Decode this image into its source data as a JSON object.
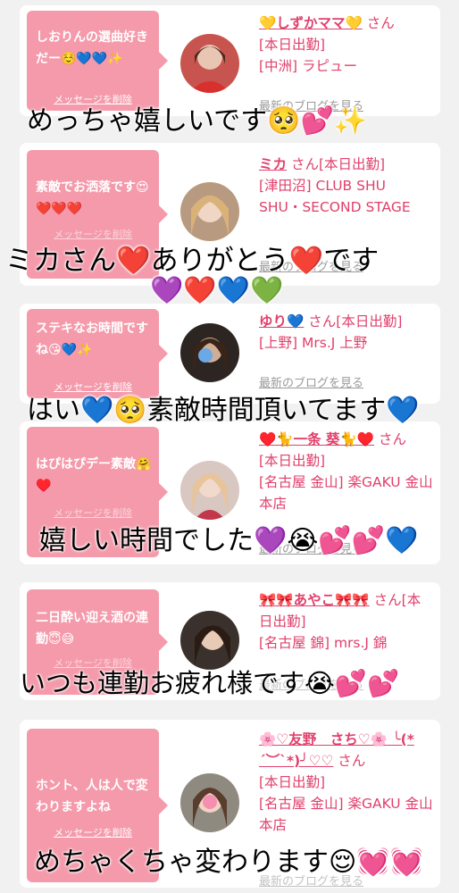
{
  "cards": [
    {
      "message": "しおりんの選曲好きだー☺️💙💙✨",
      "delete_label": "メッセージを削除",
      "name": "💛しずかママ💛",
      "san": "さん",
      "status": "[本日出勤]",
      "store": "[中洲] ラピュー",
      "blog_label": "最新のブログを見る"
    },
    {
      "message": "素敵でお洒落です😍❤️❤️❤️",
      "delete_label": "メッセージを削除",
      "name": "ミカ",
      "san": "さん",
      "status": "[本日出勤]",
      "store": "[津田沼] CLUB SHU SHU・SECOND STAGE",
      "blog_label": "最新のブログを見る"
    },
    {
      "message": "ステキなお時間ですね😘💙✨",
      "delete_label": "メッセージを削除",
      "name": "ゆり💙",
      "san": "さん",
      "status": "[本日出勤]",
      "store": "[上野] Mrs.J 上野",
      "blog_label": "最新のブログを見る"
    },
    {
      "message": "はぴはぴデー素敵🤗♥️",
      "delete_label": "メッセージを削除",
      "name": "♥️🐈一条 葵🐈♥️",
      "san": "さん",
      "status": "[本日出勤]",
      "store": "[名古屋 金山] 楽GAKU 金山本店",
      "blog_label": "最新のブログを見る"
    },
    {
      "message": "二日酔い迎え酒の連勤😇😅",
      "delete_label": "メッセージを削除",
      "name": "🎀🎀あやこ🎀🎀",
      "san": "さん",
      "status": "[本日出勤]",
      "store": "[名古屋 錦] mrs.J 錦",
      "blog_label": "最新のブログを見る"
    },
    {
      "message": "ホント、人は人で変わりますよね",
      "delete_label": "メッセージを削除",
      "name": "🌸♡友野　さち♡🌸 ╰(*´︶`*)╯♡♡",
      "san": "さん",
      "status": "[本日出勤]",
      "store": "[名古屋 金山] 楽GAKU 金山本店",
      "blog_label": "最新のブログを見る"
    }
  ],
  "comments": [
    "めっちゃ嬉しいです🥺💕✨",
    "ミカさん❤️ありがとう❤️です",
    "💜❤️💙💚",
    "はい💙🥺素敵時間頂いてます💙",
    "嬉しい時間でした💜😭💕💕💙",
    "いつも連勤お疲れ様です😭💕💕",
    "めちゃくちゃ変わります😌💓💓"
  ],
  "colors": {
    "bubble": "#f49aab",
    "name": "#e0406c",
    "link_gray": "#9a9a9a",
    "background": "#f1f1f1"
  }
}
